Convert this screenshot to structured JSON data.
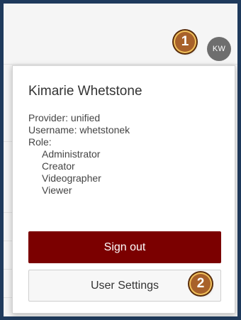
{
  "header": {
    "avatar_initials": "KW"
  },
  "callouts": {
    "one": "1",
    "two": "2"
  },
  "user_menu": {
    "name": "Kimarie Whetstone",
    "provider_line": "Provider: unified",
    "username_line": "Username: whetstonek",
    "role_heading": "Role:",
    "roles": [
      "Administrator",
      "Creator",
      "Videographer",
      "Viewer"
    ],
    "sign_out_label": "Sign out",
    "user_settings_label": "User Settings"
  },
  "colors": {
    "sign_out_bg": "#7b0000",
    "avatar_bg": "#6e6e6e",
    "callout_bg": "#a8612a",
    "frame_border": "#1f3a5c"
  }
}
